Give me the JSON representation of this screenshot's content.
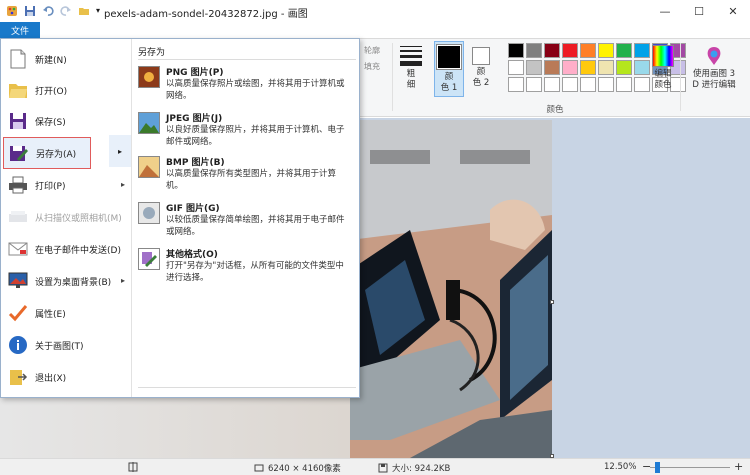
{
  "window": {
    "title": "pexels-adam-sondel-20432872.jpg - 画图",
    "minimize": "—",
    "maximize": "☐",
    "close": "✕"
  },
  "ribbon": {
    "file_tab": "文件",
    "outline_label": "轮廓",
    "fill_label": "填充",
    "size_label": "粗\n细",
    "color1_label": "颜\n色 1",
    "color2_label": "颜\n色 2",
    "edit_colors_label": "编辑\n颜色",
    "paint3d_label": "使用画图 3\nD 进行编辑",
    "colors_group_label": "颜色",
    "color1_value": "#000000",
    "color2_value": "#ffffff",
    "palette": [
      "#000000",
      "#7f7f7f",
      "#880015",
      "#ed1c24",
      "#ff7f27",
      "#fff200",
      "#22b14c",
      "#00a2e8",
      "#3f48cc",
      "#a349a4",
      "#ffffff",
      "#c3c3c3",
      "#b97a57",
      "#ffaec9",
      "#ffc90e",
      "#efe4b0",
      "#b5e61d",
      "#99d9ea",
      "#7092be",
      "#c8bfe7",
      "#ffffff",
      "#ffffff",
      "#ffffff",
      "#ffffff",
      "#ffffff",
      "#ffffff",
      "#ffffff",
      "#ffffff",
      "#ffffff",
      "#ffffff"
    ]
  },
  "file_menu": {
    "items": [
      {
        "label": "新建(N)",
        "icon": "new-file-icon",
        "has_submenu": false,
        "disabled": false
      },
      {
        "label": "打开(O)",
        "icon": "open-folder-icon",
        "has_submenu": false,
        "disabled": false
      },
      {
        "label": "保存(S)",
        "icon": "save-disk-icon",
        "has_submenu": false,
        "disabled": false
      },
      {
        "label": "另存为(A)",
        "icon": "save-as-icon",
        "has_submenu": true,
        "disabled": false
      },
      {
        "label": "打印(P)",
        "icon": "printer-icon",
        "has_submenu": true,
        "disabled": false
      },
      {
        "label": "从扫描仪或照相机(M)",
        "icon": "scanner-icon",
        "has_submenu": false,
        "disabled": true
      },
      {
        "label": "在电子邮件中发送(D)",
        "icon": "email-icon",
        "has_submenu": false,
        "disabled": false
      },
      {
        "label": "设置为桌面背景(B)",
        "icon": "desktop-background-icon",
        "has_submenu": true,
        "disabled": false
      },
      {
        "label": "属性(E)",
        "icon": "properties-check-icon",
        "has_submenu": false,
        "disabled": false
      },
      {
        "label": "关于画图(T)",
        "icon": "info-icon",
        "has_submenu": false,
        "disabled": false
      },
      {
        "label": "退出(X)",
        "icon": "exit-icon",
        "has_submenu": false,
        "disabled": false
      }
    ],
    "save_as_panel": {
      "title": "另存为",
      "formats": [
        {
          "name": "PNG 图片(P)",
          "desc": "以高质量保存照片或绘图，并将其用于计算机或网络。",
          "icon": "png-image-icon"
        },
        {
          "name": "JPEG 图片(J)",
          "desc": "以良好质量保存照片，并将其用于计算机、电子邮件或网络。",
          "icon": "jpeg-image-icon"
        },
        {
          "name": "BMP 图片(B)",
          "desc": "以高质量保存所有类型图片，并将其用于计算机。",
          "icon": "bmp-image-icon"
        },
        {
          "name": "GIF 图片(G)",
          "desc": "以较低质量保存简单绘图，并将其用于电子邮件或网络。",
          "icon": "gif-image-icon"
        },
        {
          "name": "其他格式(O)",
          "desc": "打开\"另存为\"对话框，从所有可能的文件类型中进行选择。",
          "icon": "other-formats-icon"
        }
      ]
    }
  },
  "statusbar": {
    "dimensions": "6240 × 4160像素",
    "size": "大小: 924.2KB",
    "zoom": "12.50%",
    "zoom_fraction": 0.125
  }
}
